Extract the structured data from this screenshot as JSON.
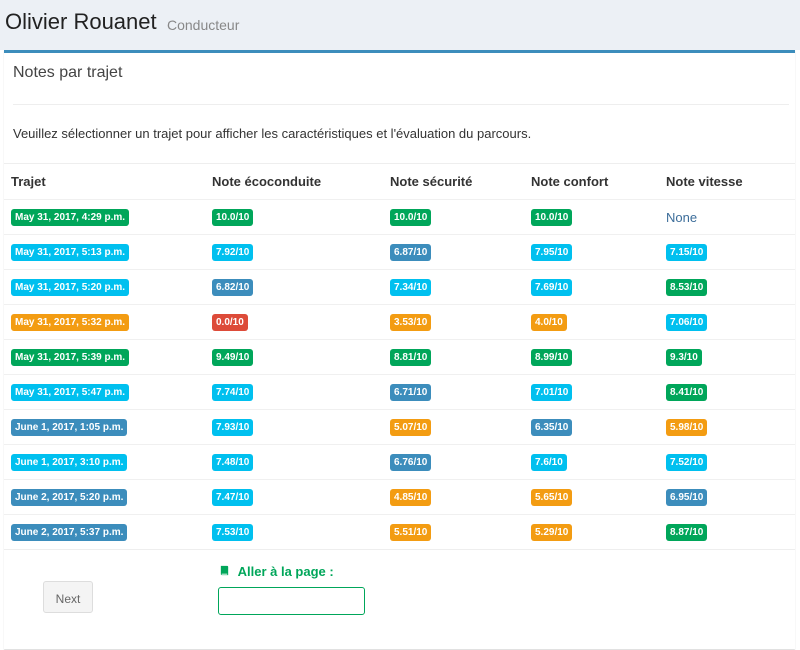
{
  "header": {
    "name": "Olivier Rouanet",
    "role": "Conducteur"
  },
  "box": {
    "title": "Notes par trajet",
    "intro": "Veuillez sélectionner un trajet pour afficher les caractéristiques et l'évaluation du parcours."
  },
  "table": {
    "headers": [
      "Trajet",
      "Note écoconduite",
      "Note sécurité",
      "Note confort",
      "Note vitesse"
    ],
    "rows": [
      {
        "trajet": "May 31, 2017, 4:29 p.m.",
        "trajet_color": "green",
        "eco": "10.0/10",
        "eco_color": "green",
        "sec": "10.0/10",
        "sec_color": "green",
        "conf": "10.0/10",
        "conf_color": "green",
        "vit": "None",
        "vit_color": "none"
      },
      {
        "trajet": "May 31, 2017, 5:13 p.m.",
        "trajet_color": "aqua",
        "eco": "7.92/10",
        "eco_color": "aqua",
        "sec": "6.87/10",
        "sec_color": "blue",
        "conf": "7.95/10",
        "conf_color": "aqua",
        "vit": "7.15/10",
        "vit_color": "aqua"
      },
      {
        "trajet": "May 31, 2017, 5:20 p.m.",
        "trajet_color": "aqua",
        "eco": "6.82/10",
        "eco_color": "blue",
        "sec": "7.34/10",
        "sec_color": "aqua",
        "conf": "7.69/10",
        "conf_color": "aqua",
        "vit": "8.53/10",
        "vit_color": "green"
      },
      {
        "trajet": "May 31, 2017, 5:32 p.m.",
        "trajet_color": "orange",
        "eco": "0.0/10",
        "eco_color": "red",
        "sec": "3.53/10",
        "sec_color": "orange",
        "conf": "4.0/10",
        "conf_color": "orange",
        "vit": "7.06/10",
        "vit_color": "aqua"
      },
      {
        "trajet": "May 31, 2017, 5:39 p.m.",
        "trajet_color": "green",
        "eco": "9.49/10",
        "eco_color": "green",
        "sec": "8.81/10",
        "sec_color": "green",
        "conf": "8.99/10",
        "conf_color": "green",
        "vit": "9.3/10",
        "vit_color": "green"
      },
      {
        "trajet": "May 31, 2017, 5:47 p.m.",
        "trajet_color": "aqua",
        "eco": "7.74/10",
        "eco_color": "aqua",
        "sec": "6.71/10",
        "sec_color": "blue",
        "conf": "7.01/10",
        "conf_color": "aqua",
        "vit": "8.41/10",
        "vit_color": "green"
      },
      {
        "trajet": "June 1, 2017, 1:05 p.m.",
        "trajet_color": "blue",
        "eco": "7.93/10",
        "eco_color": "aqua",
        "sec": "5.07/10",
        "sec_color": "orange",
        "conf": "6.35/10",
        "conf_color": "blue",
        "vit": "5.98/10",
        "vit_color": "orange"
      },
      {
        "trajet": "June 1, 2017, 3:10 p.m.",
        "trajet_color": "aqua",
        "eco": "7.48/10",
        "eco_color": "aqua",
        "sec": "6.76/10",
        "sec_color": "blue",
        "conf": "7.6/10",
        "conf_color": "aqua",
        "vit": "7.52/10",
        "vit_color": "aqua"
      },
      {
        "trajet": "June 2, 2017, 5:20 p.m.",
        "trajet_color": "blue",
        "eco": "7.47/10",
        "eco_color": "aqua",
        "sec": "4.85/10",
        "sec_color": "orange",
        "conf": "5.65/10",
        "conf_color": "orange",
        "vit": "6.95/10",
        "vit_color": "blue"
      },
      {
        "trajet": "June 2, 2017, 5:37 p.m.",
        "trajet_color": "blue",
        "eco": "7.53/10",
        "eco_color": "aqua",
        "sec": "5.51/10",
        "sec_color": "orange",
        "conf": "5.29/10",
        "conf_color": "orange",
        "vit": "8.87/10",
        "vit_color": "green"
      }
    ]
  },
  "pagination": {
    "next_label": "Next"
  },
  "goto": {
    "label": "Aller à la page :",
    "icon": "book-icon",
    "value": ""
  },
  "colors": {
    "green": "#00a65a",
    "aqua": "#00c0ef",
    "blue": "#3c8dbc",
    "orange": "#f39c12",
    "red": "#dd4b39",
    "header_accent": "#3c8dbc"
  }
}
